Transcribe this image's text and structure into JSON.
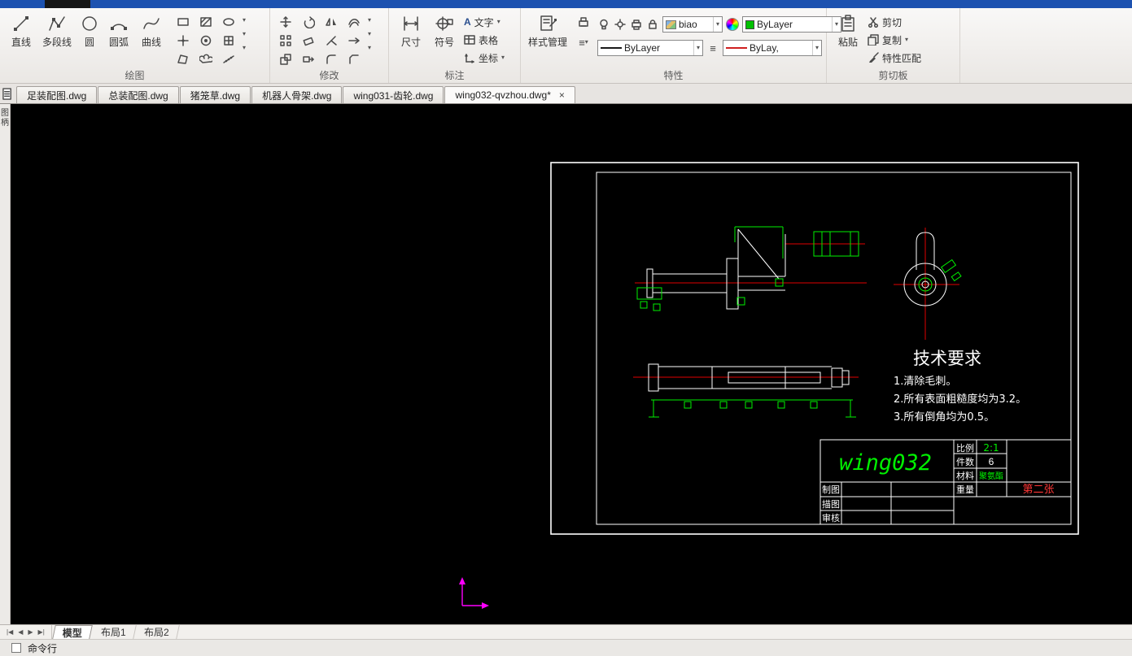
{
  "glyphs": {
    "dropdown": "▾",
    "close": "×",
    "list": "≡",
    "text_tool": "A"
  },
  "colors": {
    "titlebar_blue": "#1d52b0",
    "canvas_black": "#000000",
    "cad_white": "#ffffff",
    "cad_green": "#00f000",
    "cad_red": "#e00000",
    "ucs_magenta": "#ff00ff",
    "sheet_note_red": "#ff3636"
  },
  "ribbon": {
    "draw": {
      "label": "绘图",
      "line": "直线",
      "polyline": "多段线",
      "circle": "圆",
      "arc": "圆弧",
      "spline": "曲线",
      "small_tools": [
        "rectangle",
        "hatch",
        "ellipse",
        "point",
        "donut",
        "block",
        "region",
        "revision-cloud",
        "divide"
      ]
    },
    "modify": {
      "label": "修改",
      "small_tools": [
        "move",
        "rotate",
        "mirror",
        "offset",
        "array",
        "erase",
        "trim",
        "extend",
        "scale",
        "stretch",
        "fillet",
        "chamfer"
      ]
    },
    "annotate": {
      "label": "标注",
      "dimension": "尺寸",
      "symbol": "符号",
      "text": "文字",
      "table": "表格",
      "coordinate": "坐标"
    },
    "properties": {
      "label": "特性",
      "style_manager": "样式管理",
      "color_combo": "biao",
      "layer_combo": "ByLayer",
      "linetype_combo": "ByLayer",
      "lineweight_combo": "ByLay,",
      "small_tools": [
        "layer-on-bulb",
        "layer-brightness",
        "layer-plot",
        "layer-lock",
        "color-wheel",
        "line-list"
      ]
    },
    "clipboard": {
      "label": "剪切板",
      "paste": "粘贴",
      "cut": "剪切",
      "copy": "复制",
      "match_props": "特性匹配"
    }
  },
  "doc_tabs": [
    {
      "label": "足装配图.dwg",
      "active": false
    },
    {
      "label": "总装配图.dwg",
      "active": false
    },
    {
      "label": "猪笼草.dwg",
      "active": false
    },
    {
      "label": "机器人骨架.dwg",
      "active": false
    },
    {
      "label": "wing031-齿轮.dwg",
      "active": false
    },
    {
      "label": "wing032-qvzhou.dwg*",
      "active": true
    }
  ],
  "sidebar": {
    "chars": [
      "图",
      "柄"
    ]
  },
  "drawing": {
    "tech_title": "技术要求",
    "notes": [
      "1.清除毛刺。",
      "2.所有表面粗糙度均为3.2。",
      "3.所有倒角均为0.5。"
    ],
    "title_block": {
      "part_name": "wing032",
      "scale_label": "比例",
      "scale_value": "2:1",
      "qty_label": "件数",
      "qty_value": "6",
      "material_label": "材料",
      "material_value": "聚氨酯",
      "weight_label": "重量",
      "sheet_label": "第二张",
      "drawn_label": "制图",
      "trace_label": "描图",
      "check_label": "审核"
    }
  },
  "layout_bar": {
    "tabs": [
      {
        "label": "模型",
        "active": true
      },
      {
        "label": "布局1",
        "active": false
      },
      {
        "label": "布局2",
        "active": false
      }
    ]
  },
  "command_bar": {
    "label": "命令行"
  }
}
